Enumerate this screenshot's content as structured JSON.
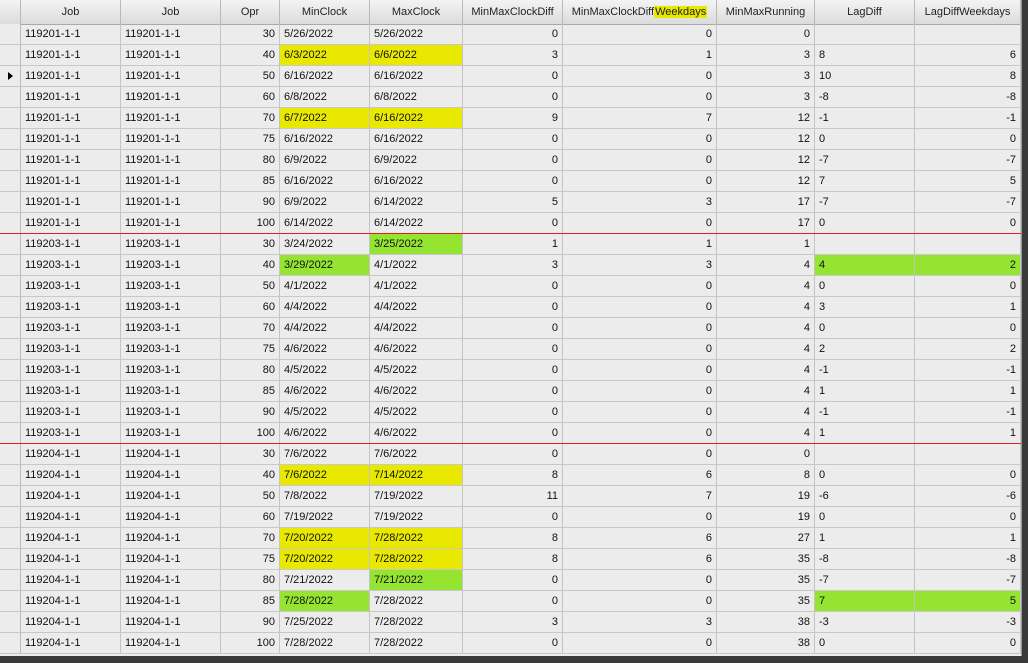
{
  "columns": [
    "Job",
    "Job",
    "Opr",
    "MinClock",
    "MaxClock",
    "MinMaxClockDiff",
    "MinMaxClockDiff",
    "Weekdays",
    "MinMaxRunning",
    "LagDiff",
    "LagDiffWeekdays"
  ],
  "colors": {
    "yellow": "#e8e800",
    "green": "#96e432",
    "separator": "#e02020"
  },
  "current_row_index": 2,
  "rows": [
    {
      "job1": "119201-1-1",
      "job2": "119201-1-1",
      "opr": "30",
      "min": "5/26/2022",
      "max": "5/26/2022",
      "diff": "0",
      "diffwd": "0",
      "running": "0",
      "lag": "",
      "lagwd": "",
      "hl": {}
    },
    {
      "job1": "119201-1-1",
      "job2": "119201-1-1",
      "opr": "40",
      "min": "6/3/2022",
      "max": "6/6/2022",
      "diff": "3",
      "diffwd": "1",
      "running": "3",
      "lag": "8",
      "lagwd": "6",
      "hl": {
        "min": "y",
        "max": "y"
      }
    },
    {
      "job1": "119201-1-1",
      "job2": "119201-1-1",
      "opr": "50",
      "min": "6/16/2022",
      "max": "6/16/2022",
      "diff": "0",
      "diffwd": "0",
      "running": "3",
      "lag": "10",
      "lagwd": "8",
      "hl": {}
    },
    {
      "job1": "119201-1-1",
      "job2": "119201-1-1",
      "opr": "60",
      "min": "6/8/2022",
      "max": "6/8/2022",
      "diff": "0",
      "diffwd": "0",
      "running": "3",
      "lag": "-8",
      "lagwd": "-8",
      "hl": {}
    },
    {
      "job1": "119201-1-1",
      "job2": "119201-1-1",
      "opr": "70",
      "min": "6/7/2022",
      "max": "6/16/2022",
      "diff": "9",
      "diffwd": "7",
      "running": "12",
      "lag": "-1",
      "lagwd": "-1",
      "hl": {
        "min": "y",
        "max": "y"
      }
    },
    {
      "job1": "119201-1-1",
      "job2": "119201-1-1",
      "opr": "75",
      "min": "6/16/2022",
      "max": "6/16/2022",
      "diff": "0",
      "diffwd": "0",
      "running": "12",
      "lag": "0",
      "lagwd": "0",
      "hl": {}
    },
    {
      "job1": "119201-1-1",
      "job2": "119201-1-1",
      "opr": "80",
      "min": "6/9/2022",
      "max": "6/9/2022",
      "diff": "0",
      "diffwd": "0",
      "running": "12",
      "lag": "-7",
      "lagwd": "-7",
      "hl": {}
    },
    {
      "job1": "119201-1-1",
      "job2": "119201-1-1",
      "opr": "85",
      "min": "6/16/2022",
      "max": "6/16/2022",
      "diff": "0",
      "diffwd": "0",
      "running": "12",
      "lag": "7",
      "lagwd": "5",
      "hl": {}
    },
    {
      "job1": "119201-1-1",
      "job2": "119201-1-1",
      "opr": "90",
      "min": "6/9/2022",
      "max": "6/14/2022",
      "diff": "5",
      "diffwd": "3",
      "running": "17",
      "lag": "-7",
      "lagwd": "-7",
      "hl": {}
    },
    {
      "job1": "119201-1-1",
      "job2": "119201-1-1",
      "opr": "100",
      "min": "6/14/2022",
      "max": "6/14/2022",
      "diff": "0",
      "diffwd": "0",
      "running": "17",
      "lag": "0",
      "lagwd": "0",
      "hl": {}
    },
    {
      "job1": "119203-1-1",
      "job2": "119203-1-1",
      "opr": "30",
      "min": "3/24/2022",
      "max": "3/25/2022",
      "diff": "1",
      "diffwd": "1",
      "running": "1",
      "lag": "",
      "lagwd": "",
      "hl": {
        "max": "g"
      },
      "sep": true
    },
    {
      "job1": "119203-1-1",
      "job2": "119203-1-1",
      "opr": "40",
      "min": "3/29/2022",
      "max": "4/1/2022",
      "diff": "3",
      "diffwd": "3",
      "running": "4",
      "lag": "4",
      "lagwd": "2",
      "hl": {
        "min": "g",
        "lag": "g",
        "lagwd": "g"
      }
    },
    {
      "job1": "119203-1-1",
      "job2": "119203-1-1",
      "opr": "50",
      "min": "4/1/2022",
      "max": "4/1/2022",
      "diff": "0",
      "diffwd": "0",
      "running": "4",
      "lag": "0",
      "lagwd": "0",
      "hl": {}
    },
    {
      "job1": "119203-1-1",
      "job2": "119203-1-1",
      "opr": "60",
      "min": "4/4/2022",
      "max": "4/4/2022",
      "diff": "0",
      "diffwd": "0",
      "running": "4",
      "lag": "3",
      "lagwd": "1",
      "hl": {}
    },
    {
      "job1": "119203-1-1",
      "job2": "119203-1-1",
      "opr": "70",
      "min": "4/4/2022",
      "max": "4/4/2022",
      "diff": "0",
      "diffwd": "0",
      "running": "4",
      "lag": "0",
      "lagwd": "0",
      "hl": {}
    },
    {
      "job1": "119203-1-1",
      "job2": "119203-1-1",
      "opr": "75",
      "min": "4/6/2022",
      "max": "4/6/2022",
      "diff": "0",
      "diffwd": "0",
      "running": "4",
      "lag": "2",
      "lagwd": "2",
      "hl": {}
    },
    {
      "job1": "119203-1-1",
      "job2": "119203-1-1",
      "opr": "80",
      "min": "4/5/2022",
      "max": "4/5/2022",
      "diff": "0",
      "diffwd": "0",
      "running": "4",
      "lag": "-1",
      "lagwd": "-1",
      "hl": {}
    },
    {
      "job1": "119203-1-1",
      "job2": "119203-1-1",
      "opr": "85",
      "min": "4/6/2022",
      "max": "4/6/2022",
      "diff": "0",
      "diffwd": "0",
      "running": "4",
      "lag": "1",
      "lagwd": "1",
      "hl": {}
    },
    {
      "job1": "119203-1-1",
      "job2": "119203-1-1",
      "opr": "90",
      "min": "4/5/2022",
      "max": "4/5/2022",
      "diff": "0",
      "diffwd": "0",
      "running": "4",
      "lag": "-1",
      "lagwd": "-1",
      "hl": {}
    },
    {
      "job1": "119203-1-1",
      "job2": "119203-1-1",
      "opr": "100",
      "min": "4/6/2022",
      "max": "4/6/2022",
      "diff": "0",
      "diffwd": "0",
      "running": "4",
      "lag": "1",
      "lagwd": "1",
      "hl": {}
    },
    {
      "job1": "119204-1-1",
      "job2": "119204-1-1",
      "opr": "30",
      "min": "7/6/2022",
      "max": "7/6/2022",
      "diff": "0",
      "diffwd": "0",
      "running": "0",
      "lag": "",
      "lagwd": "",
      "hl": {},
      "sep": true
    },
    {
      "job1": "119204-1-1",
      "job2": "119204-1-1",
      "opr": "40",
      "min": "7/6/2022",
      "max": "7/14/2022",
      "diff": "8",
      "diffwd": "6",
      "running": "8",
      "lag": "0",
      "lagwd": "0",
      "hl": {
        "min": "y",
        "max": "y"
      }
    },
    {
      "job1": "119204-1-1",
      "job2": "119204-1-1",
      "opr": "50",
      "min": "7/8/2022",
      "max": "7/19/2022",
      "diff": "11",
      "diffwd": "7",
      "running": "19",
      "lag": "-6",
      "lagwd": "-6",
      "hl": {}
    },
    {
      "job1": "119204-1-1",
      "job2": "119204-1-1",
      "opr": "60",
      "min": "7/19/2022",
      "max": "7/19/2022",
      "diff": "0",
      "diffwd": "0",
      "running": "19",
      "lag": "0",
      "lagwd": "0",
      "hl": {}
    },
    {
      "job1": "119204-1-1",
      "job2": "119204-1-1",
      "opr": "70",
      "min": "7/20/2022",
      "max": "7/28/2022",
      "diff": "8",
      "diffwd": "6",
      "running": "27",
      "lag": "1",
      "lagwd": "1",
      "hl": {
        "min": "y",
        "max": "y"
      }
    },
    {
      "job1": "119204-1-1",
      "job2": "119204-1-1",
      "opr": "75",
      "min": "7/20/2022",
      "max": "7/28/2022",
      "diff": "8",
      "diffwd": "6",
      "running": "35",
      "lag": "-8",
      "lagwd": "-8",
      "hl": {
        "min": "y",
        "max": "y"
      }
    },
    {
      "job1": "119204-1-1",
      "job2": "119204-1-1",
      "opr": "80",
      "min": "7/21/2022",
      "max": "7/21/2022",
      "diff": "0",
      "diffwd": "0",
      "running": "35",
      "lag": "-7",
      "lagwd": "-7",
      "hl": {
        "max": "g"
      }
    },
    {
      "job1": "119204-1-1",
      "job2": "119204-1-1",
      "opr": "85",
      "min": "7/28/2022",
      "max": "7/28/2022",
      "diff": "0",
      "diffwd": "0",
      "running": "35",
      "lag": "7",
      "lagwd": "5",
      "hl": {
        "min": "g",
        "lag": "g",
        "lagwd": "g"
      }
    },
    {
      "job1": "119204-1-1",
      "job2": "119204-1-1",
      "opr": "90",
      "min": "7/25/2022",
      "max": "7/28/2022",
      "diff": "3",
      "diffwd": "3",
      "running": "38",
      "lag": "-3",
      "lagwd": "-3",
      "hl": {}
    },
    {
      "job1": "119204-1-1",
      "job2": "119204-1-1",
      "opr": "100",
      "min": "7/28/2022",
      "max": "7/28/2022",
      "diff": "0",
      "diffwd": "0",
      "running": "38",
      "lag": "0",
      "lagwd": "0",
      "hl": {}
    }
  ]
}
